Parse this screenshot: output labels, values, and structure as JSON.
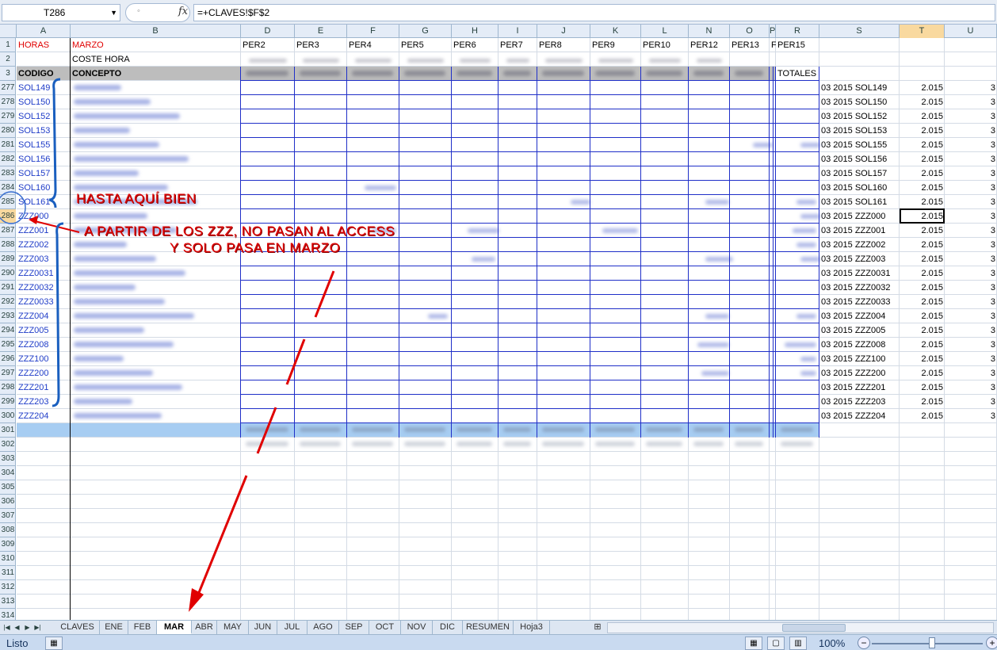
{
  "formula_bar": {
    "name_box": "T286",
    "fx_label": "fx",
    "formula": "=+CLAVES!$F$2"
  },
  "columns": [
    "A",
    "B",
    "D",
    "E",
    "F",
    "G",
    "H",
    "I",
    "J",
    "K",
    "L",
    "N",
    "O",
    "P",
    "R",
    "S",
    "T",
    "U"
  ],
  "selected_column": "T",
  "rows_top": [
    "1",
    "2",
    "3"
  ],
  "row_numbers": [
    "277",
    "278",
    "279",
    "280",
    "281",
    "282",
    "283",
    "284",
    "285",
    "286",
    "287",
    "288",
    "289",
    "290",
    "291",
    "292",
    "293",
    "294",
    "295",
    "296",
    "297",
    "298",
    "299",
    "300",
    "301",
    "302",
    "303",
    "304",
    "305",
    "306",
    "307",
    "308",
    "309",
    "310",
    "311",
    "312",
    "313",
    "314"
  ],
  "selected_row": "286",
  "header": {
    "horas": "HORAS",
    "marzo": "MARZO",
    "coste_hora": "COSTE HORA",
    "codigo": "CODIGO",
    "concepto": "CONCEPTO",
    "totales": "TOTALES",
    "periods": [
      "PER2",
      "PER3",
      "PER4",
      "PER5",
      "PER6",
      "PER7",
      "PER8",
      "PER9",
      "PER10",
      "PER12",
      "PER13",
      "PER15"
    ],
    "p_col_label": "F"
  },
  "data_rows": [
    {
      "code": "SOL149",
      "s": "03 2015 SOL149",
      "t": "2.015",
      "u": "3"
    },
    {
      "code": "SOL150",
      "s": "03 2015 SOL150",
      "t": "2.015",
      "u": "3"
    },
    {
      "code": "SOL152",
      "s": "03 2015 SOL152",
      "t": "2.015",
      "u": "3"
    },
    {
      "code": "SOL153",
      "s": "03 2015 SOL153",
      "t": "2.015",
      "u": "3"
    },
    {
      "code": "SOL155",
      "s": "03 2015 SOL155",
      "t": "2.015",
      "u": "3"
    },
    {
      "code": "SOL156",
      "s": "03 2015 SOL156",
      "t": "2.015",
      "u": "3"
    },
    {
      "code": "SOL157",
      "s": "03 2015 SOL157",
      "t": "2.015",
      "u": "3"
    },
    {
      "code": "SOL160",
      "s": "03 2015 SOL160",
      "t": "2.015",
      "u": "3"
    },
    {
      "code": "SOL161",
      "s": "03 2015 SOL161",
      "t": "2.015",
      "u": "3"
    },
    {
      "code": "ZZZ000",
      "s": "03 2015 ZZZ000",
      "t": "2.015",
      "u": "3"
    },
    {
      "code": "ZZZ001",
      "s": "03 2015 ZZZ001",
      "t": "2.015",
      "u": "3"
    },
    {
      "code": "ZZZ002",
      "s": "03 2015 ZZZ002",
      "t": "2.015",
      "u": "3"
    },
    {
      "code": "ZZZ003",
      "s": "03 2015 ZZZ003",
      "t": "2.015",
      "u": "3"
    },
    {
      "code": "ZZZ0031",
      "s": "03 2015 ZZZ0031",
      "t": "2.015",
      "u": "3"
    },
    {
      "code": "ZZZ0032",
      "s": "03 2015 ZZZ0032",
      "t": "2.015",
      "u": "3"
    },
    {
      "code": "ZZZ0033",
      "s": "03 2015 ZZZ0033",
      "t": "2.015",
      "u": "3"
    },
    {
      "code": "ZZZ004",
      "s": "03 2015 ZZZ004",
      "t": "2.015",
      "u": "3"
    },
    {
      "code": "ZZZ005",
      "s": "03 2015 ZZZ005",
      "t": "2.015",
      "u": "3"
    },
    {
      "code": "ZZZ008",
      "s": "03 2015 ZZZ008",
      "t": "2.015",
      "u": "3"
    },
    {
      "code": "ZZZ100",
      "s": "03 2015 ZZZ100",
      "t": "2.015",
      "u": "3"
    },
    {
      "code": "ZZZ200",
      "s": "03 2015 ZZZ200",
      "t": "2.015",
      "u": "3"
    },
    {
      "code": "ZZZ201",
      "s": "03 2015 ZZZ201",
      "t": "2.015",
      "u": "3"
    },
    {
      "code": "ZZZ203",
      "s": "03 2015 ZZZ203",
      "t": "2.015",
      "u": "3"
    },
    {
      "code": "ZZZ204",
      "s": "03 2015 ZZZ204",
      "t": "2.015",
      "u": "3"
    }
  ],
  "annotations": {
    "line1": "HASTA AQUÍ BIEN",
    "line2": "A PARTIR DE LOS ZZZ, NO PASAN AL ACCESS",
    "line3": "Y SOLO PASA EN MARZO",
    "color": "#e00000"
  },
  "sheet_tabs": [
    "CLAVES",
    "ENE",
    "FEB",
    "MAR",
    "ABR",
    "MAY",
    "JUN",
    "JUL",
    "AGO",
    "SEP",
    "OCT",
    "NOV",
    "DIC",
    "RESUMEN",
    "Hoja3"
  ],
  "active_tab": "MAR",
  "status": {
    "ready": "Listo",
    "zoom": "100%"
  }
}
